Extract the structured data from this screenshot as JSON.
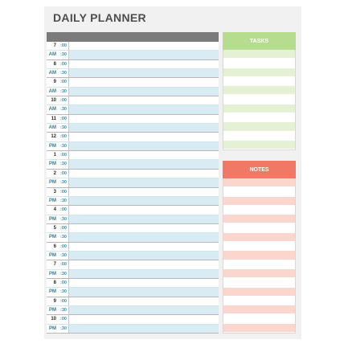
{
  "title": "DAILY PLANNER",
  "schedule": [
    {
      "hour": "7",
      "meridiem": "AM"
    },
    {
      "hour": "8",
      "meridiem": "AM"
    },
    {
      "hour": "9",
      "meridiem": "AM"
    },
    {
      "hour": "10",
      "meridiem": "AM"
    },
    {
      "hour": "11",
      "meridiem": "AM"
    },
    {
      "hour": "12",
      "meridiem": "PM"
    },
    {
      "hour": "1",
      "meridiem": "PM"
    },
    {
      "hour": "2",
      "meridiem": "PM"
    },
    {
      "hour": "3",
      "meridiem": "PM"
    },
    {
      "hour": "4",
      "meridiem": "PM"
    },
    {
      "hour": "5",
      "meridiem": "PM"
    },
    {
      "hour": "6",
      "meridiem": "PM"
    },
    {
      "hour": "7",
      "meridiem": "PM"
    },
    {
      "hour": "8",
      "meridiem": "PM"
    },
    {
      "hour": "9",
      "meridiem": "PM"
    },
    {
      "hour": "10",
      "meridiem": "PM"
    }
  ],
  "minute_marks": [
    ":00",
    ":30"
  ],
  "tasks": {
    "header": "TASKS",
    "lines": 11
  },
  "notes": {
    "header": "NOTES",
    "lines": 17
  },
  "colors": {
    "schedule_header": "#7b7b7b",
    "schedule_fill": "#d9ecf3",
    "tasks_accent": "#b5dd8d",
    "tasks_fill": "#e4f1d5",
    "notes_accent": "#f07864",
    "notes_fill": "#fbd6ce"
  }
}
